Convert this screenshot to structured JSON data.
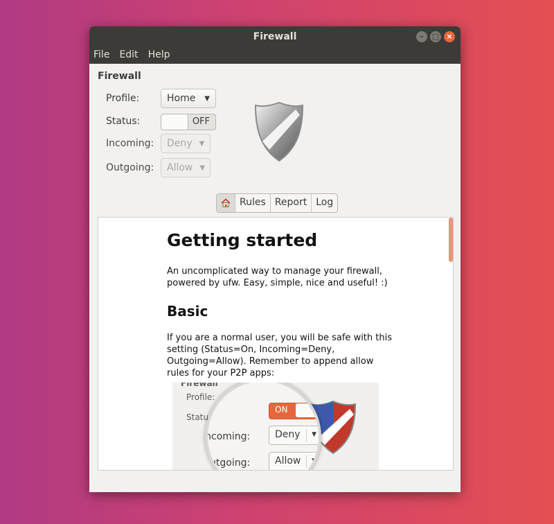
{
  "window": {
    "title": "Firewall",
    "controls": [
      "–",
      "□",
      "×"
    ]
  },
  "menu": [
    "File",
    "Edit",
    "Help"
  ],
  "firewall": {
    "section_title": "Firewall",
    "profile": {
      "label": "Profile:",
      "value": "Home"
    },
    "status": {
      "label": "Status:",
      "value": "OFF"
    },
    "incoming": {
      "label": "Incoming:",
      "value": "Deny"
    },
    "outgoing": {
      "label": "Outgoing:",
      "value": "Allow"
    }
  },
  "tabs": [
    "Rules",
    "Report",
    "Log"
  ],
  "doc": {
    "heading": "Getting started",
    "intro": "An uncomplicated way to manage your firewall, powered by ufw. Easy, simple, nice and useful! :)",
    "subheading": "Basic",
    "basic_text": "If you are a normal user, you will be safe with this setting (Status=On, Incoming=Deny, Outgoing=Allow). Remember to append allow rules for your P2P apps:"
  },
  "preview": {
    "section_title": "Firewall",
    "labels": [
      "Profile:",
      "Statu",
      "Incoming:",
      "Outgoing:"
    ],
    "magnified": {
      "status": "ON",
      "incoming_label": "Incoming:",
      "incoming": "Deny",
      "outgoing_label": "Outgoing:",
      "outgoing": "Allow"
    }
  },
  "colors": {
    "accent": "#e9663d",
    "titlebar": "#3d3b37",
    "window_bg": "#f2f1f0"
  }
}
